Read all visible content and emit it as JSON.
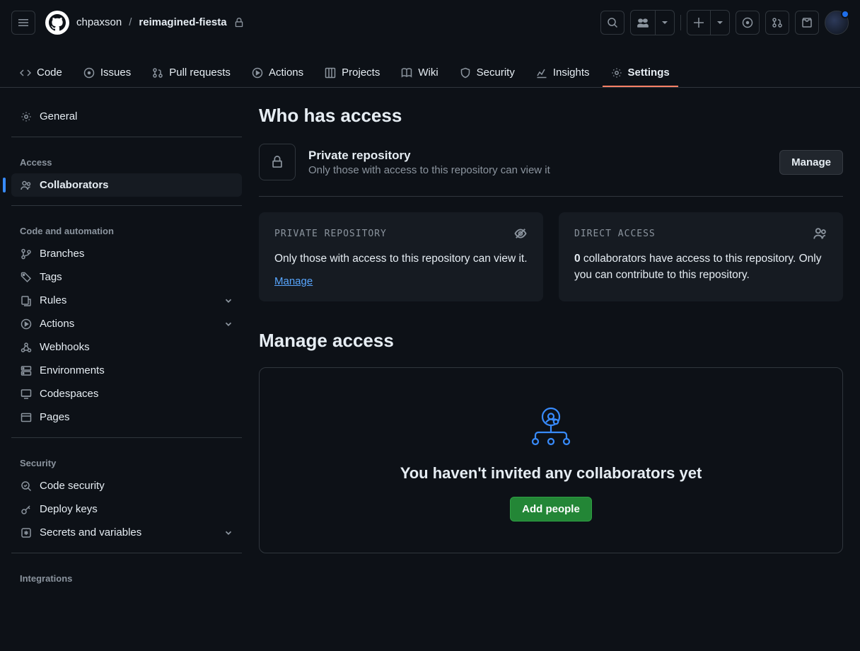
{
  "header": {
    "owner": "chpaxson",
    "repo": "reimagined-fiesta"
  },
  "repoNav": {
    "code": "Code",
    "issues": "Issues",
    "pulls": "Pull requests",
    "actions": "Actions",
    "projects": "Projects",
    "wiki": "Wiki",
    "security": "Security",
    "insights": "Insights",
    "settings": "Settings"
  },
  "sidebar": {
    "general": "General",
    "sections": {
      "access": "Access",
      "codeAutomation": "Code and automation",
      "security": "Security",
      "integrations": "Integrations"
    },
    "items": {
      "collaborators": "Collaborators",
      "branches": "Branches",
      "tags": "Tags",
      "rules": "Rules",
      "actions": "Actions",
      "webhooks": "Webhooks",
      "environments": "Environments",
      "codespaces": "Codespaces",
      "pages": "Pages",
      "codeSecurity": "Code security",
      "deployKeys": "Deploy keys",
      "secrets": "Secrets and variables"
    }
  },
  "main": {
    "title": "Who has access",
    "accessHeader": {
      "title": "Private repository",
      "subtitle": "Only those with access to this repository can view it",
      "manageBtn": "Manage"
    },
    "cards": {
      "private": {
        "label": "PRIVATE REPOSITORY",
        "body": "Only those with access to this repository can view it.",
        "link": "Manage"
      },
      "direct": {
        "label": "DIRECT ACCESS",
        "count": "0",
        "body_after_count": " collaborators have access to this repository. Only you can contribute to this repository."
      }
    },
    "manageAccess": {
      "title": "Manage access",
      "empty": "You haven't invited any collaborators yet",
      "button": "Add people"
    }
  }
}
